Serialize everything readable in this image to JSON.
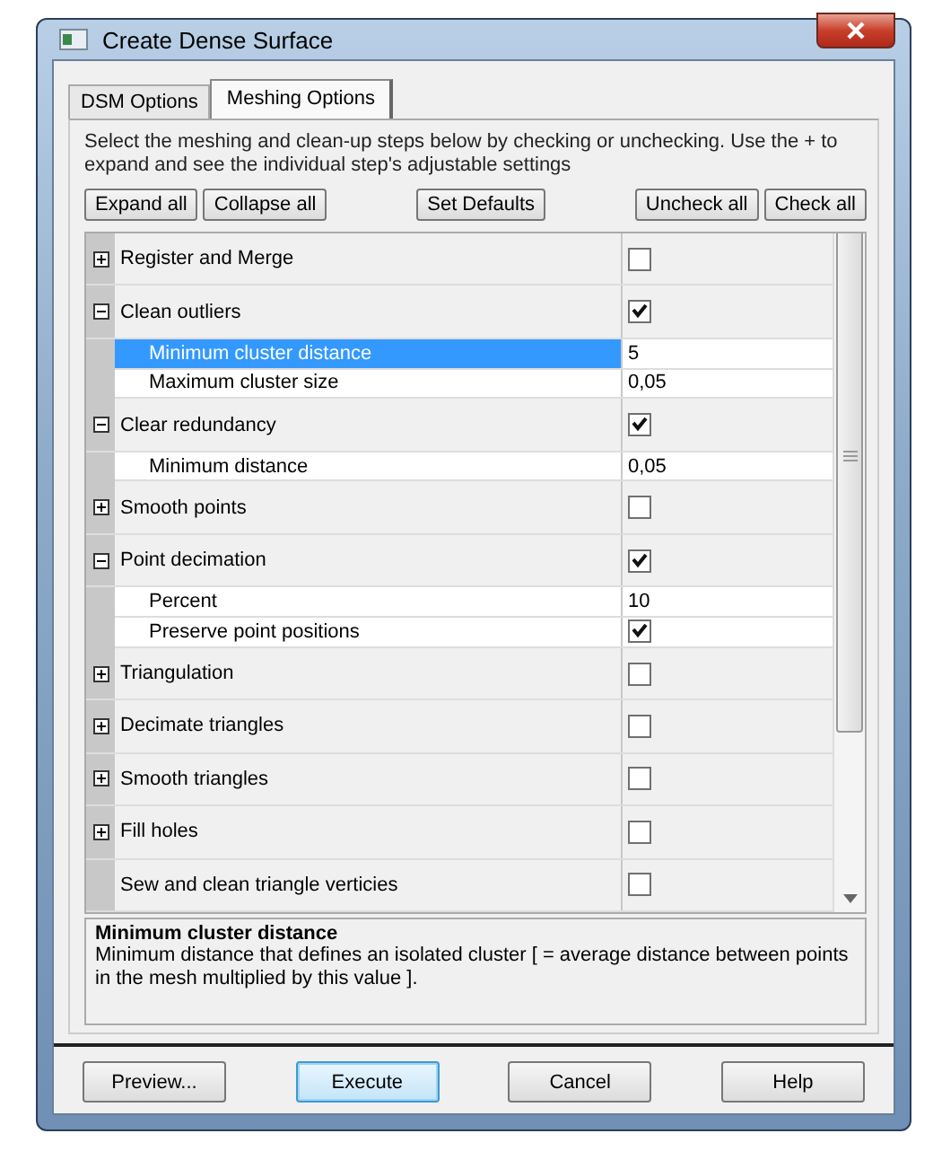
{
  "window": {
    "title": "Create Dense Surface"
  },
  "tabs": [
    {
      "label": "DSM Options",
      "selected": false
    },
    {
      "label": "Meshing Options",
      "selected": true
    }
  ],
  "instructions": "Select the meshing and clean-up steps below by checking or unchecking. Use the + to expand and see the individual step's adjustable settings",
  "toolbar_buttons": [
    [
      "Expand all",
      "Collapse all"
    ],
    [
      "Set Defaults"
    ],
    [
      "Uncheck all",
      "Check all"
    ]
  ],
  "steps": [
    {
      "name": "Register and Merge",
      "expanded": false,
      "checked": false
    },
    {
      "name": "Clean outliers",
      "expanded": true,
      "checked": true,
      "children": [
        {
          "kind": "value",
          "name": "Minimum cluster distance",
          "value": "5",
          "selected": true
        },
        {
          "kind": "value",
          "name": "Maximum cluster size",
          "value": "0,05",
          "selected": false
        }
      ]
    },
    {
      "name": "Clear redundancy",
      "expanded": true,
      "checked": true,
      "children": [
        {
          "kind": "value",
          "name": "Minimum distance",
          "value": "0,05",
          "selected": false
        }
      ]
    },
    {
      "name": "Smooth points",
      "expanded": false,
      "checked": false
    },
    {
      "name": "Point decimation",
      "expanded": true,
      "checked": true,
      "children": [
        {
          "kind": "value",
          "name": "Percent",
          "value": "10",
          "selected": false
        },
        {
          "kind": "checkbox",
          "name": "Preserve point positions",
          "checked": true,
          "selected": false
        }
      ]
    },
    {
      "name": "Triangulation",
      "expanded": false,
      "checked": false
    },
    {
      "name": "Decimate triangles",
      "expanded": false,
      "checked": false
    },
    {
      "name": "Smooth triangles",
      "expanded": false,
      "checked": false
    },
    {
      "name": "Fill holes",
      "expanded": false,
      "checked": false
    },
    {
      "name": "Sew and clean triangle verticies",
      "checked": false
    }
  ],
  "help_panel": {
    "title": "Minimum cluster distance",
    "text": "Minimum distance that defines an isolated cluster [ = average distance between points in the mesh multiplied by this value ]."
  },
  "dialog_buttons": [
    {
      "label": "Preview...",
      "default": false
    },
    {
      "label": "Execute",
      "default": true
    },
    {
      "label": "Cancel",
      "default": false
    },
    {
      "label": "Help",
      "default": false
    }
  ]
}
